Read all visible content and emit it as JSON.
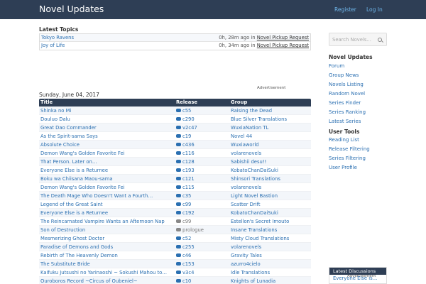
{
  "header": {
    "brand": "Novel Updates",
    "register": "Register",
    "login": "Log In"
  },
  "latest_topics": {
    "title": "Latest Topics",
    "rows": [
      {
        "topic": "Tokyo Ravens",
        "ago": "0h, 28m ago in",
        "category": "Novel Pickup Request"
      },
      {
        "topic": "Joy of Life",
        "ago": "0h, 34m ago in",
        "category": "Novel Pickup Request"
      }
    ]
  },
  "ad_label": "Advertisement",
  "releases": {
    "date": "Sunday, June 04, 2017",
    "headers": {
      "title": "Title",
      "release": "Release",
      "group": "Group"
    },
    "rows": [
      {
        "title": "Shinka no Mi",
        "release": "c55",
        "group": "Raising the Dead",
        "gray": false
      },
      {
        "title": "Douluo Dalu",
        "release": "c290",
        "group": "Blue Silver Translations",
        "gray": false
      },
      {
        "title": "Great Dao Commander",
        "release": "v2c47",
        "group": "WuxiaNation TL",
        "gray": false
      },
      {
        "title": "As the Spirit-sama Says",
        "release": "c19",
        "group": "Novel 44",
        "gray": false
      },
      {
        "title": "Absolute Choice",
        "release": "c436",
        "group": "Wuxiaworld",
        "gray": false
      },
      {
        "title": "Demon Wang's Golden Favorite Fei",
        "release": "c116",
        "group": "volarenovels",
        "gray": false
      },
      {
        "title": "That Person. Later on…",
        "release": "c128",
        "group": "Sabishii desu!!",
        "gray": false
      },
      {
        "title": "Everyone Else is a Returnee",
        "release": "c193",
        "group": "KobatoChanDaiSuki",
        "gray": false
      },
      {
        "title": "Boku wa Chiisana Maou-sama",
        "release": "c121",
        "group": "Shinsori Translations",
        "gray": false
      },
      {
        "title": "Demon Wang's Golden Favorite Fei",
        "release": "c115",
        "group": "volarenovels",
        "gray": false
      },
      {
        "title": "The Death Mage Who Doesn't Want a Fourth…",
        "release": "c35",
        "group": "Light Novel Bastion",
        "gray": false
      },
      {
        "title": "Legend of the Great Saint",
        "release": "c99",
        "group": "Scatter Drift",
        "gray": false
      },
      {
        "title": "Everyone Else is a Returnee",
        "release": "c192",
        "group": "KobatoChanDaiSuki",
        "gray": false
      },
      {
        "title": "The Reincarnated Vampire Wants an Afternoon Nap",
        "release": "c99",
        "group": "Estellon's Secret Imouto",
        "gray": true
      },
      {
        "title": "Son of Destruction",
        "release": "prologue",
        "group": "Insane Translations",
        "gray": true
      },
      {
        "title": "Mesmerizing Ghost Doctor",
        "release": "c52",
        "group": "Misty Cloud Translations",
        "gray": false
      },
      {
        "title": "Paradise of Demons and Gods",
        "release": "c255",
        "group": "volarenovels",
        "gray": false
      },
      {
        "title": "Rebirth of The Heavenly Demon",
        "release": "c46",
        "group": "Gravity Tales",
        "gray": false
      },
      {
        "title": "The Substitute Bride",
        "release": "c153",
        "group": "azurro4cielo",
        "gray": false
      },
      {
        "title": "Kaifuku Jutsushi no Yarinaoshi ~ Sokushi Mahou to…",
        "release": "v3c4",
        "group": "Idle Translations",
        "gray": false
      },
      {
        "title": "Ouroboros Record ~Circus of Oubeniel~",
        "release": "c10",
        "group": "Knights of Lunadia",
        "gray": false
      }
    ]
  },
  "sidebar": {
    "search_placeholder": "Search Novels...",
    "nu_title": "Novel Updates",
    "nu_links": [
      "Forum",
      "Group News",
      "Novels Listing",
      "Random Novel",
      "Series Finder",
      "Series Ranking",
      "Latest Series"
    ],
    "tools_title": "User Tools",
    "tools_links": [
      "Reading List",
      "Release Filtering",
      "Series Filtering",
      "User Profile"
    ],
    "latest_discussions_title": "Latest Discussions",
    "latest_discussions_item": "Everyone Else is…"
  },
  "colors": {
    "navbar": "#2e3e55",
    "link": "#2a6fb1",
    "toplink": "#6fb6ea"
  },
  "icons": {
    "release": "comment-icon",
    "search": "search-icon"
  }
}
